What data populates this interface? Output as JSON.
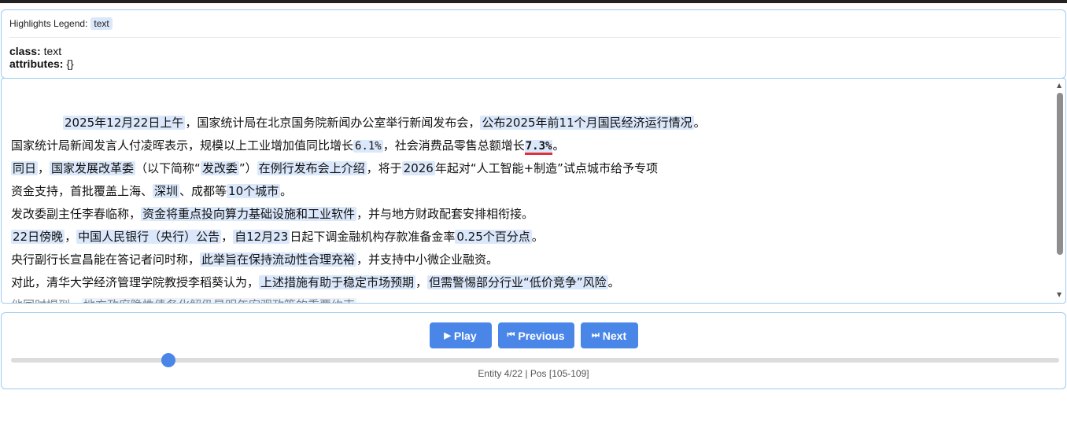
{
  "legend": {
    "label": "Highlights Legend:",
    "chip": "text"
  },
  "meta": {
    "class_label": "class:",
    "class_value": "text",
    "attributes_label": "attributes:",
    "attributes_value": "{}"
  },
  "text_lines": [
    [
      {
        "t": "2025年12月22日上午",
        "h": true
      },
      {
        "t": "，国家统计局在北京国务院新闻办公室举行新闻发布会，"
      },
      {
        "t": "公布2025年前11个月国民经济运行情况",
        "h": true
      },
      {
        "t": "。"
      }
    ],
    [
      {
        "t": "国家统计局新闻发言人付凌晖表示，规模以上工业增加值同比增长"
      },
      {
        "t": "6.1%",
        "h": true,
        "m": true
      },
      {
        "t": "，社会消费品零售总额增长"
      },
      {
        "t": "7.3%",
        "active": true
      },
      {
        "t": "。"
      }
    ],
    [
      {
        "t": "同日",
        "h": true
      },
      {
        "t": "，"
      },
      {
        "t": "国家发展改革委",
        "h": true
      },
      {
        "t": "（以下简称“"
      },
      {
        "t": "发改委",
        "h": true
      },
      {
        "t": "”）"
      },
      {
        "t": "在例行发布会上介绍",
        "h": true
      },
      {
        "t": "，将于"
      },
      {
        "t": "2026",
        "h": true
      },
      {
        "t": "年起对“人工智能+制造”试点城市给予专项"
      }
    ],
    [
      {
        "t": "资金支持，首批覆盖上海、"
      },
      {
        "t": "深圳",
        "h": true
      },
      {
        "t": "、成都等"
      },
      {
        "t": "10个城市",
        "h": true
      },
      {
        "t": "。"
      }
    ],
    [
      {
        "t": "发改委副主任李春临称，"
      },
      {
        "t": "资金将重点投向算力基础设施和工业软件",
        "h": true
      },
      {
        "t": "，并与地方财政配套安排相衔接。"
      }
    ],
    [
      {
        "t": "22日傍晚",
        "h": true
      },
      {
        "t": "，"
      },
      {
        "t": "中国人民银行（央行）公告",
        "h": true
      },
      {
        "t": "，"
      },
      {
        "t": "自12月23",
        "h": true
      },
      {
        "t": "日起下调金融机构存款准备金率"
      },
      {
        "t": "0.25个百分点",
        "h": true
      },
      {
        "t": "。"
      }
    ],
    [
      {
        "t": "央行副行长宣昌能在答记者问时称，"
      },
      {
        "t": "此举旨在保持流动性合理充裕",
        "h": true
      },
      {
        "t": "，并支持中小微企业融资。"
      }
    ],
    [
      {
        "t": "对此，清华大学经济管理学院教授李稻葵认为，"
      },
      {
        "t": "上述措施有助于稳定市场预期",
        "h": true
      },
      {
        "t": "，"
      },
      {
        "t": "但需警惕部分行业“低价竞争”风险",
        "h": true
      },
      {
        "t": "。"
      }
    ],
    [
      {
        "t": "他同时提到，"
      },
      {
        "t": "地方政府隐性债务化解仍是明年宏观政策的重要约束",
        "h": true
      },
      {
        "t": "。"
      }
    ]
  ],
  "controls": {
    "play_icon": "▶",
    "play_label": "Play",
    "prev_icon": "⏮",
    "prev_label": "Previous",
    "next_icon": "⏭",
    "next_label": "Next",
    "slider_value": 0.15,
    "status": "Entity 4/22 | Pos [105-109]"
  },
  "colors": {
    "accent": "#4a86e8",
    "highlight": "#dbe8fb",
    "active_underline": "#e0303a",
    "panel_border": "#9ecbf0"
  }
}
